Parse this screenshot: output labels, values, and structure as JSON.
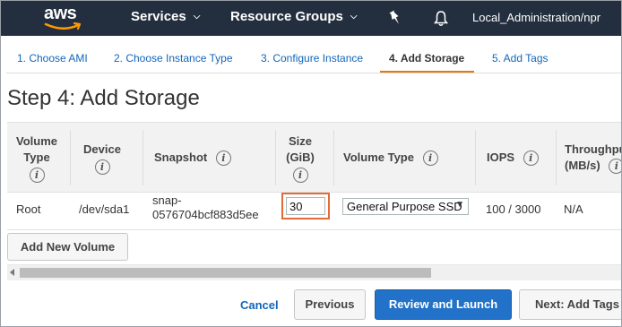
{
  "topnav": {
    "logo_text": "aws",
    "services_label": "Services",
    "resource_groups_label": "Resource Groups",
    "account_label": "Local_Administration/npr",
    "bg_color": "#232f3e",
    "logo_accent": "#ff9900"
  },
  "wizard": {
    "tabs": [
      {
        "label": "1. Choose AMI"
      },
      {
        "label": "2. Choose Instance Type"
      },
      {
        "label": "3. Configure Instance"
      },
      {
        "label": "4. Add Storage",
        "active": true
      },
      {
        "label": "5. Add Tags"
      }
    ],
    "accent_color": "#e47911"
  },
  "page_title": "Step 4: Add Storage",
  "table": {
    "headers": {
      "volume_type": [
        "Volume",
        "Type"
      ],
      "device": "Device",
      "snapshot": "Snapshot",
      "size": [
        "Size",
        "(GiB)"
      ],
      "volume_type2": "Volume Type",
      "iops": "IOPS",
      "throughput": [
        "Throughput",
        "(MB/s)"
      ]
    },
    "info_glyph": "i",
    "rows": [
      {
        "volume_type": "Root",
        "device": "/dev/sda1",
        "snapshot": [
          "snap-",
          "0576704bcf883d5ee"
        ],
        "size": "30",
        "volume_type2": "General Purpose SSD",
        "iops": "100 / 3000",
        "throughput": "N/A"
      }
    ]
  },
  "add_volume_label": "Add New Volume",
  "footer": {
    "cancel_label": "Cancel",
    "previous_label": "Previous",
    "review_label": "Review and Launch",
    "next_label": "Next: Add Tags"
  },
  "icons": {
    "pin": "pin-icon",
    "bell": "bell-icon",
    "info": "info-icon"
  }
}
